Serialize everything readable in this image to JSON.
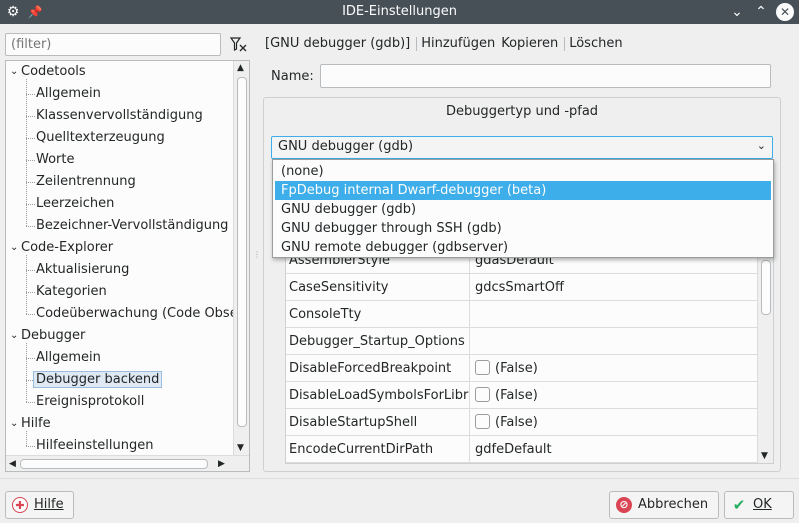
{
  "window": {
    "title": "IDE-Einstellungen"
  },
  "filter": {
    "placeholder": "(filter)"
  },
  "tree": {
    "items": [
      {
        "label": "Codetools",
        "level": 0,
        "expanded": true
      },
      {
        "label": "Allgemein",
        "level": 1
      },
      {
        "label": "Klassenvervollständigung",
        "level": 1
      },
      {
        "label": "Quelltexterzeugung",
        "level": 1
      },
      {
        "label": "Worte",
        "level": 1
      },
      {
        "label": "Zeilentrennung",
        "level": 1
      },
      {
        "label": "Leerzeichen",
        "level": 1
      },
      {
        "label": "Bezeichner-Vervollständigung",
        "level": 1
      },
      {
        "label": "Code-Explorer",
        "level": 0,
        "expanded": true
      },
      {
        "label": "Aktualisierung",
        "level": 1
      },
      {
        "label": "Kategorien",
        "level": 1
      },
      {
        "label": "Codeüberwachung (Code Obser",
        "level": 1
      },
      {
        "label": "Debugger",
        "level": 0,
        "expanded": true
      },
      {
        "label": "Allgemein",
        "level": 1
      },
      {
        "label": "Debugger backend",
        "level": 1,
        "selected": true
      },
      {
        "label": "Ereignisprotokoll",
        "level": 1
      },
      {
        "label": "Hilfe",
        "level": 0,
        "expanded": true
      },
      {
        "label": "Hilfeeinstellungen",
        "level": 1
      }
    ]
  },
  "toolbar": {
    "dropdown_label": "[GNU debugger (gdb)]",
    "add_label": "Hinzufügen",
    "copy_label": "Kopieren",
    "delete_label": "Löschen"
  },
  "form": {
    "name_label": "Name:",
    "name_value": "",
    "group_title": "Debuggertyp und -pfad",
    "debugger_type": "GNU debugger (gdb)"
  },
  "type_options": [
    {
      "label": "(none)"
    },
    {
      "label": "FpDebug internal Dwarf-debugger (beta)",
      "selected": true
    },
    {
      "label": "GNU debugger (gdb)"
    },
    {
      "label": "GNU debugger through SSH (gdb)"
    },
    {
      "label": "GNU remote debugger (gdbserver)"
    }
  ],
  "properties": [
    {
      "name": "AssemblerStyle",
      "value": "gdasDefault",
      "checkbox": false
    },
    {
      "name": "CaseSensitivity",
      "value": "gdcsSmartOff",
      "checkbox": false
    },
    {
      "name": "ConsoleTty",
      "value": "",
      "checkbox": false
    },
    {
      "name": "Debugger_Startup_Options",
      "value": "",
      "checkbox": false
    },
    {
      "name": "DisableForcedBreakpoint",
      "value": "(False)",
      "checkbox": true
    },
    {
      "name": "DisableLoadSymbolsForLibrar",
      "value": "(False)",
      "checkbox": true
    },
    {
      "name": "DisableStartupShell",
      "value": "(False)",
      "checkbox": true
    },
    {
      "name": "EncodeCurrentDirPath",
      "value": "gdfeDefault",
      "checkbox": false
    }
  ],
  "buttons": {
    "help_label": "Hilfe",
    "cancel_label": "Abbrechen",
    "ok_label": "OK"
  },
  "colors": {
    "titlebar": "#475057",
    "accent": "#3daee9",
    "cancel_icon": "#da4453",
    "ok_icon": "#27ae60"
  }
}
